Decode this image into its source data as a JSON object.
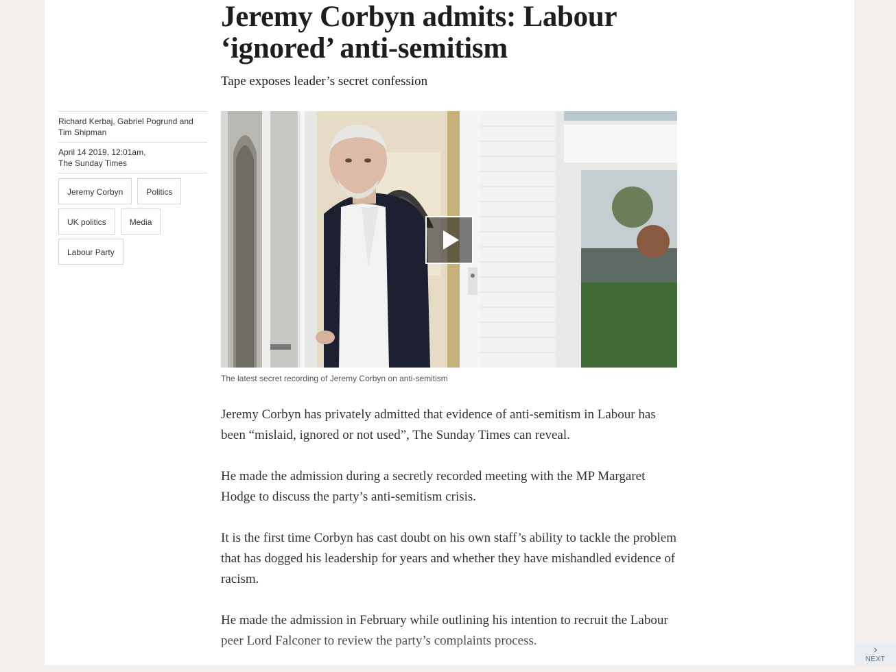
{
  "article": {
    "headline": "Jeremy Corbyn admits: Labour ‘ignored’ anti-semitism",
    "standfirst": "Tape exposes leader’s secret confession",
    "authors": "Richard Kerbaj, Gabriel Pogrund and Tim Shipman",
    "date": "April 14 2019, 12:01am,",
    "publication": "The Sunday Times",
    "tags": [
      "Jeremy Corbyn",
      "Politics",
      "UK politics",
      "Media",
      "Labour Party"
    ],
    "media": {
      "caption": "The latest secret recording of Jeremy Corbyn on anti-semitism",
      "play_icon": "play-icon"
    },
    "paragraphs": [
      "Jeremy Corbyn has privately admitted that evidence of anti-semitism in Labour has been “mislaid, ignored or not used”, The Sunday Times can reveal.",
      "He made the admission during a secretly recorded meeting with the MP Margaret Hodge to discuss the party’s anti-semitism crisis.",
      "It is the first time Corbyn has cast doubt on his own staff’s ability to tackle the problem that has dogged his leadership for years and whether they have mishandled evidence of racism.",
      "He made the admission in February while outlining his intention to recruit the Labour peer Lord Falconer to review the party’s complaints process."
    ]
  },
  "navigation": {
    "next_label": "NEXT",
    "next_icon": "chevron-right-icon"
  },
  "colors": {
    "page_background": "#f3efec",
    "content_background": "#ffffff",
    "text": "#1d1d1b",
    "next_accent": "#4f6e8a"
  }
}
